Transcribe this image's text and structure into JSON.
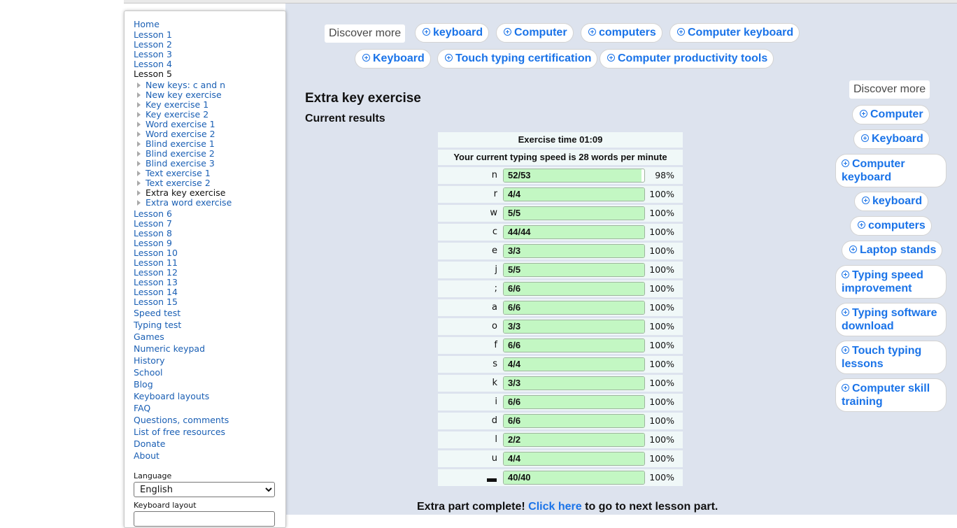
{
  "nav": {
    "lessons_before": [
      "Home",
      "Lesson 1",
      "Lesson 2",
      "Lesson 3",
      "Lesson 4"
    ],
    "current_lesson": "Lesson 5",
    "sub_items": [
      "New keys: c and n",
      "New key exercise",
      "Key exercise 1",
      "Key exercise 2",
      "Word exercise 1",
      "Word exercise 2",
      "Blind exercise 1",
      "Blind exercise 2",
      "Blind exercise 3",
      "Text exercise 1",
      "Text exercise 2",
      "Extra key exercise",
      "Extra word exercise"
    ],
    "current_sub_item": "Extra key exercise",
    "lessons_after": [
      "Lesson 6",
      "Lesson 7",
      "Lesson 8",
      "Lesson 9",
      "Lesson 10",
      "Lesson 11",
      "Lesson 12",
      "Lesson 13",
      "Lesson 14",
      "Lesson 15"
    ],
    "other_links": [
      "Speed test",
      "Typing test",
      "Games",
      "Numeric keypad",
      "History",
      "School",
      "Blog",
      "Keyboard layouts",
      "FAQ",
      "Questions, comments",
      "List of free resources",
      "Donate",
      "About"
    ]
  },
  "settings": {
    "language_label": "Language",
    "language_value": "English",
    "keyboard_layout_label": "Keyboard layout"
  },
  "discover_top": {
    "label": "Discover more",
    "row1": [
      "keyboard",
      "Computer",
      "computers",
      "Computer keyboard"
    ],
    "row2": [
      "Keyboard",
      "Touch typing certification",
      "Computer productivity tools"
    ]
  },
  "discover_side": {
    "label": "Discover more",
    "items": [
      "Computer",
      "Keyboard",
      "Computer keyboard",
      "keyboard",
      "computers",
      "Laptop stands",
      "Typing speed improvement",
      "Typing software download",
      "Touch typing lessons",
      "Computer skill training"
    ]
  },
  "page_title": "Extra key exercise",
  "results": {
    "heading": "Current results",
    "exercise_time": "Exercise time 01:09",
    "speed_text": "Your current typing speed is 28 words per minute",
    "rows": [
      {
        "key": "n",
        "score": "52/53",
        "percent": "98%",
        "fill": 0.98
      },
      {
        "key": "r",
        "score": "4/4",
        "percent": "100%",
        "fill": 1
      },
      {
        "key": "w",
        "score": "5/5",
        "percent": "100%",
        "fill": 1
      },
      {
        "key": "c",
        "score": "44/44",
        "percent": "100%",
        "fill": 1
      },
      {
        "key": "e",
        "score": "3/3",
        "percent": "100%",
        "fill": 1
      },
      {
        "key": "j",
        "score": "5/5",
        "percent": "100%",
        "fill": 1
      },
      {
        "key": ";",
        "score": "6/6",
        "percent": "100%",
        "fill": 1
      },
      {
        "key": "a",
        "score": "6/6",
        "percent": "100%",
        "fill": 1
      },
      {
        "key": "o",
        "score": "3/3",
        "percent": "100%",
        "fill": 1
      },
      {
        "key": "f",
        "score": "6/6",
        "percent": "100%",
        "fill": 1
      },
      {
        "key": "s",
        "score": "4/4",
        "percent": "100%",
        "fill": 1
      },
      {
        "key": "k",
        "score": "3/3",
        "percent": "100%",
        "fill": 1
      },
      {
        "key": "i",
        "score": "6/6",
        "percent": "100%",
        "fill": 1
      },
      {
        "key": "d",
        "score": "6/6",
        "percent": "100%",
        "fill": 1
      },
      {
        "key": "l",
        "score": "2/2",
        "percent": "100%",
        "fill": 1
      },
      {
        "key": "u",
        "score": "4/4",
        "percent": "100%",
        "fill": 1
      },
      {
        "key": "",
        "score": "40/40",
        "percent": "100%",
        "fill": 1,
        "space": true
      }
    ]
  },
  "completion": {
    "prefix": "Extra part complete!",
    "link": "Click here",
    "suffix": "to go to next lesson part."
  },
  "colors": {
    "link": "#1a5fb4",
    "pill_text": "#1a73e8",
    "progress_fill": "#c3f7c3",
    "main_background": "#dde3ee"
  }
}
